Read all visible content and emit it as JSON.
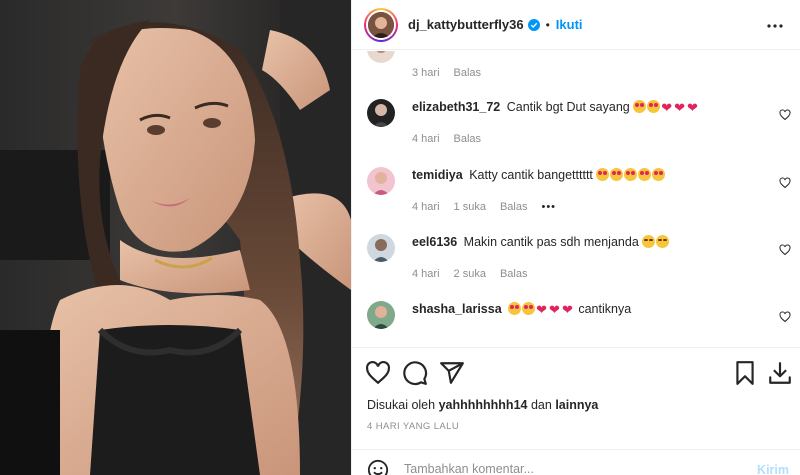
{
  "header": {
    "username": "dj_kattybutterfly36",
    "separator": "•",
    "follow_label": "Ikuti",
    "verified_icon": "verified-badge-icon",
    "more_icon": "more-horizontal-icon"
  },
  "comments": [
    {
      "user": "",
      "text": "",
      "meta": {
        "time": "3 hari",
        "likes": "",
        "reply": "Balas"
      }
    },
    {
      "user": "elizabeth31_72",
      "text": "Cantik bgt Dut sayang",
      "meta": {
        "time": "4 hari",
        "likes": "",
        "reply": "Balas"
      }
    },
    {
      "user": "temidiya",
      "text": "Katty cantik bangetttttt",
      "meta": {
        "time": "4 hari",
        "likes": "1 suka",
        "reply": "Balas",
        "more": "•••"
      }
    },
    {
      "user": "eel6136",
      "text": "Makin cantik pas sdh menjanda",
      "meta": {
        "time": "4 hari",
        "likes": "2 suka",
        "reply": "Balas"
      }
    },
    {
      "user": "shasha_larissa",
      "text": "cantiknya",
      "meta": {}
    }
  ],
  "actions": {
    "icons": [
      "heart-icon",
      "comment-icon",
      "share-icon",
      "bookmark-icon",
      "download-icon"
    ]
  },
  "likes": {
    "prefix": "Disukai oleh",
    "user": "yahhhhhhhh14",
    "conj": "dan",
    "others": "lainnya"
  },
  "date": "4 HARI YANG LALU",
  "add_comment": {
    "placeholder": "Tambahkan komentar...",
    "post_label": "Kirim"
  },
  "colors": {
    "accent": "#0095f6",
    "heart": "#e0245e",
    "muted": "#8e8e8e"
  }
}
